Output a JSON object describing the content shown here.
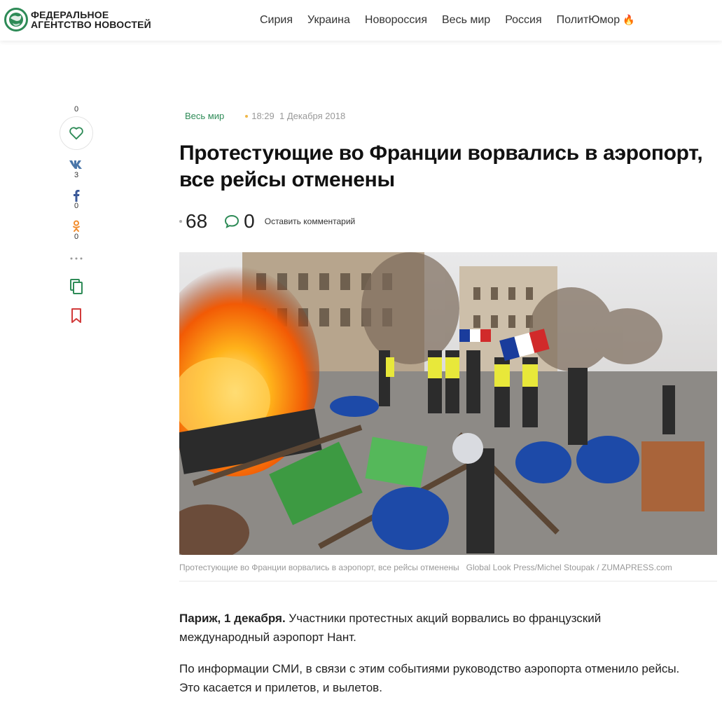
{
  "header": {
    "logo_line1": "ФЕДЕРАЛЬНОЕ",
    "logo_line2": "АГЕНТСТВО НОВОСТЕЙ",
    "nav": [
      "Сирия",
      "Украина",
      "Новороссия",
      "Весь мир",
      "Россия",
      "ПолитЮмор"
    ],
    "accent_color": "#2e8b57"
  },
  "share": {
    "likes": "0",
    "vk_count": "3",
    "fb_count": "0",
    "ok_count": "0",
    "icons": [
      "heart-icon",
      "vk-icon",
      "facebook-icon",
      "odnoklassniki-icon",
      "more-icon",
      "copy-icon",
      "bookmark-icon"
    ]
  },
  "article": {
    "rubric": "Весь мир",
    "time": "18:29",
    "date": "1 Декабря 2018",
    "title": "Протестующие во Франции ворвались в аэропорт, все рейсы отменены",
    "views": "68",
    "comments": "0",
    "leave_comment": "Оставить комментарий",
    "caption": "Протестующие во Франции ворвались в аэропорт, все рейсы отменены",
    "credit": "Global Look Press/Michel Stoupak / ZUMAPRESS.com",
    "lead_bold": "Париж, 1 декабря.",
    "lead_text": " Участники протестных акций ворвались во французский международный аэропорт Нант.",
    "paragraph2": "По информации СМИ, в связи с этим событиями руководство аэропорта отменило рейсы. Это касается и прилетов, и вылетов."
  }
}
